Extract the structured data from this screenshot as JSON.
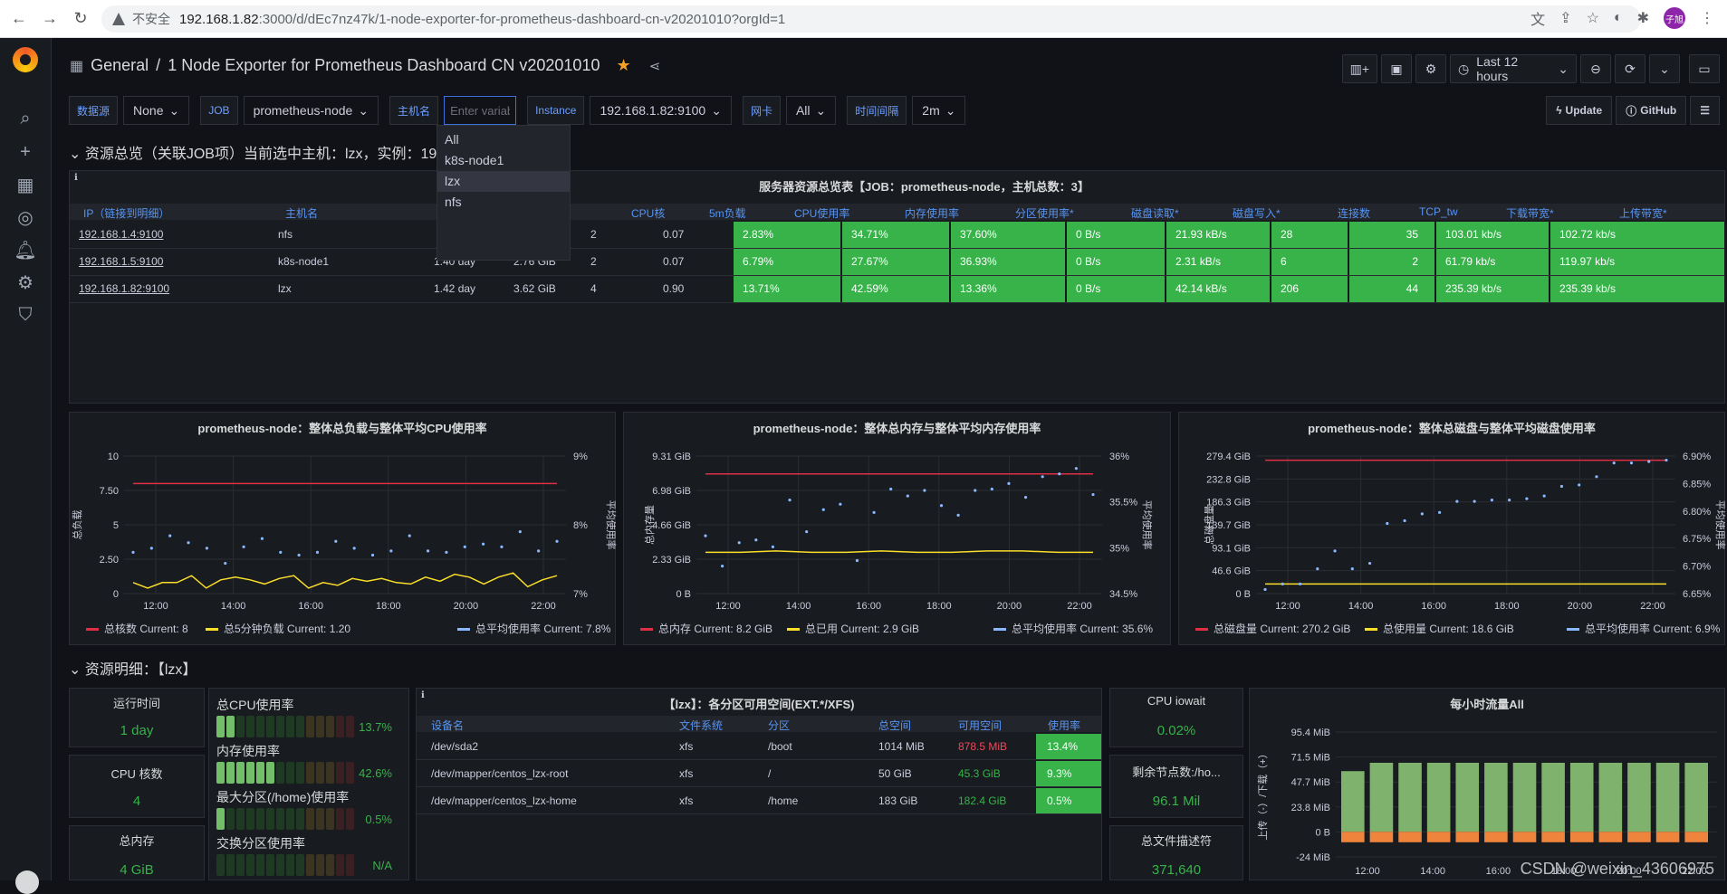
{
  "browser": {
    "insecure_label": "不安全",
    "url_host": "192.168.1.82",
    "url_path": ":3000/d/dEc7nz47k/1-node-exporter-for-prometheus-dashboard-cn-v20201010?orgId=1",
    "profile_label": "子旭"
  },
  "header": {
    "folder": "General",
    "separator": "/",
    "dashboard_title": "1 Node Exporter for Prometheus Dashboard CN v20201010",
    "time_range": "Last 12 hours"
  },
  "variables": [
    {
      "label": "数据源",
      "value": "None"
    },
    {
      "label": "JOB",
      "value": "prometheus-node"
    },
    {
      "label": "主机名",
      "value": "",
      "placeholder": "Enter variable value"
    },
    {
      "label": "Instance",
      "value": "192.168.1.82:9100"
    },
    {
      "label": "网卡",
      "value": "All"
    },
    {
      "label": "时间间隔",
      "value": "2m"
    }
  ],
  "buttons": {
    "update": "Update",
    "github": "GitHub"
  },
  "hostname_dropdown": [
    "All",
    "k8s-node1",
    "lzx",
    "nfs"
  ],
  "row1_title": "资源总览（关联JOB项）当前选中主机：lzx，实例：19",
  "overview": {
    "title": "服务器资源总览表【JOB：prometheus-node，主机总数：3】",
    "columns": [
      "IP（链接到明细）",
      "主机名",
      "",
      "",
      "CPU核",
      "5m负载",
      "CPU使用率",
      "内存使用率",
      "分区使用率*",
      "磁盘读取*",
      "磁盘写入*",
      "连接数",
      "TCP_tw",
      "下载带宽*",
      "上传带宽*"
    ],
    "rows": [
      {
        "ip": "192.168.1.4:9100",
        "host": "nfs",
        "uptime": "",
        "mem": "iB",
        "cpu": "2",
        "load": "0.07",
        "cpu_use": "2.83%",
        "mem_use": "34.71%",
        "part_use": "37.60%",
        "disk_r": "0 B/s",
        "disk_w": "21.93 kB/s",
        "conn": "28",
        "tcp_tw": "35",
        "down": "103.01 kb/s",
        "up": "102.72 kb/s"
      },
      {
        "ip": "192.168.1.5:9100",
        "host": "k8s-node1",
        "uptime": "1.40 day",
        "mem": "2.76 GiB",
        "cpu": "2",
        "load": "0.07",
        "cpu_use": "6.79%",
        "mem_use": "27.67%",
        "part_use": "36.93%",
        "disk_r": "0 B/s",
        "disk_w": "2.31 kB/s",
        "conn": "6",
        "tcp_tw": "2",
        "down": "61.79 kb/s",
        "up": "119.97 kb/s"
      },
      {
        "ip": "192.168.1.82:9100",
        "host": "lzx",
        "uptime": "1.42 day",
        "mem": "3.62 GiB",
        "cpu": "4",
        "load": "0.90",
        "cpu_use": "13.71%",
        "mem_use": "42.59%",
        "part_use": "13.36%",
        "disk_r": "0 B/s",
        "disk_w": "42.14 kB/s",
        "conn": "206",
        "tcp_tw": "44",
        "down": "235.39 kb/s",
        "up": "235.39 kb/s"
      }
    ]
  },
  "charts": [
    {
      "title": "prometheus-node：整体总负载与整体平均CPU使用率",
      "y_left_label": "总负载",
      "y_right_label": "平均使用率",
      "y_left_ticks": [
        "10",
        "7.50",
        "5",
        "2.50",
        "0"
      ],
      "y_right_ticks": [
        "9%",
        "8%",
        "7%"
      ],
      "x_ticks": [
        "12:00",
        "14:00",
        "16:00",
        "18:00",
        "20:00",
        "22:00"
      ],
      "legend": [
        {
          "name": "总核数",
          "current": "Current: 8",
          "color": "#e02f44"
        },
        {
          "name": "总5分钟负载",
          "current": "Current: 1.20",
          "color": "#fade2a"
        },
        {
          "name": "总平均使用率",
          "current": "Current: 7.8%",
          "color": "#8ab8ff"
        }
      ]
    },
    {
      "title": "prometheus-node：整体总内存与整体平均内存使用率",
      "y_left_label": "总内存量",
      "y_right_label": "平均使用率",
      "y_left_ticks": [
        "9.31 GiB",
        "6.98 GiB",
        "4.66 GiB",
        "2.33 GiB",
        "0 B"
      ],
      "y_right_ticks": [
        "36%",
        "35.5%",
        "35%",
        "34.5%"
      ],
      "x_ticks": [
        "12:00",
        "14:00",
        "16:00",
        "18:00",
        "20:00",
        "22:00"
      ],
      "legend": [
        {
          "name": "总内存",
          "current": "Current: 8.2 GiB",
          "color": "#e02f44"
        },
        {
          "name": "总已用",
          "current": "Current: 2.9 GiB",
          "color": "#fade2a"
        },
        {
          "name": "总平均使用率",
          "current": "Current: 35.6%",
          "color": "#8ab8ff"
        }
      ]
    },
    {
      "title": "prometheus-node：整体总磁盘与整体平均磁盘使用率",
      "y_left_label": "总磁盘量",
      "y_right_label": "平均使用率",
      "y_left_ticks": [
        "279.4 GiB",
        "232.8 GiB",
        "186.3 GiB",
        "139.7 GiB",
        "93.1 GiB",
        "46.6 GiB",
        "0 B"
      ],
      "y_right_ticks": [
        "6.90%",
        "6.85%",
        "6.80%",
        "6.75%",
        "6.70%",
        "6.65%"
      ],
      "x_ticks": [
        "12:00",
        "14:00",
        "16:00",
        "18:00",
        "20:00",
        "22:00"
      ],
      "legend": [
        {
          "name": "总磁盘量",
          "current": "Current: 270.2 GiB",
          "color": "#e02f44"
        },
        {
          "name": "总使用量",
          "current": "Current: 18.6 GiB",
          "color": "#fade2a"
        },
        {
          "name": "总平均使用率",
          "current": "Current: 6.9%",
          "color": "#8ab8ff"
        }
      ]
    }
  ],
  "row2_title": "资源明细：【lzx】",
  "stats": {
    "uptime": {
      "title": "运行时间",
      "value": "1 day"
    },
    "cpu_cores": {
      "title": "CPU 核数",
      "value": "4"
    },
    "total_mem": {
      "title": "总内存",
      "value": "4 GiB"
    },
    "iowait": {
      "title": "CPU iowait",
      "value": "0.02%"
    },
    "inodes": {
      "title": "剩余节点数:/ho...",
      "value": "96.1 Mil"
    },
    "fds": {
      "title": "总文件描述符",
      "value": "371,640"
    }
  },
  "gauges": [
    {
      "label": "总CPU使用率",
      "value": "13.7%",
      "level": 0.137
    },
    {
      "label": "内存使用率",
      "value": "42.6%",
      "level": 0.426
    },
    {
      "label": "最大分区(/home)使用率",
      "value": "0.5%",
      "level": 0.005
    },
    {
      "label": "交换分区使用率",
      "value": "N/A",
      "level": 0
    }
  ],
  "partitions": {
    "title": "【lzx】：各分区可用空间(EXT.*/XFS)",
    "columns": [
      "设备名",
      "文件系统",
      "分区",
      "总空间",
      "可用空间",
      "使用率"
    ],
    "rows": [
      {
        "dev": "/dev/sda2",
        "fs": "xfs",
        "mount": "/boot",
        "total": "1014 MiB",
        "avail": "878.5 MiB",
        "avail_color": "#f2495c",
        "use": "13.4%"
      },
      {
        "dev": "/dev/mapper/centos_lzx-root",
        "fs": "xfs",
        "mount": "/",
        "total": "50 GiB",
        "avail": "45.3 GiB",
        "avail_color": "#37b34a",
        "use": "9.3%"
      },
      {
        "dev": "/dev/mapper/centos_lzx-home",
        "fs": "xfs",
        "mount": "/home",
        "total": "183 GiB",
        "avail": "182.4 GiB",
        "avail_color": "#37b34a",
        "use": "0.5%"
      }
    ]
  },
  "hourly": {
    "title": "每小时流量All",
    "y_label": "上传（-）/下载（+）",
    "y_ticks": [
      "95.4 MiB",
      "71.5 MiB",
      "47.7 MiB",
      "23.8 MiB",
      "0 B",
      "-24 MiB"
    ],
    "x_ticks": [
      "12:00",
      "14:00",
      "16:00",
      "18:00",
      "20:00",
      "22:00"
    ]
  },
  "chart_data": {
    "type": "bar",
    "title": "每小时流量All",
    "ylabel": "上传（-）/下载（+）",
    "ylim": [
      -24,
      95.4
    ],
    "series": [
      {
        "name": "download",
        "values": [
          58,
          66,
          66,
          66,
          66,
          66,
          66,
          66,
          66,
          66,
          66,
          66,
          66
        ]
      },
      {
        "name": "upload",
        "values": [
          -10,
          -10,
          -10,
          -10,
          -10,
          -10,
          -10,
          -10,
          -10,
          -10,
          -10,
          -10,
          -10
        ]
      }
    ]
  },
  "watermark": "CSDN @weixin_43606975"
}
